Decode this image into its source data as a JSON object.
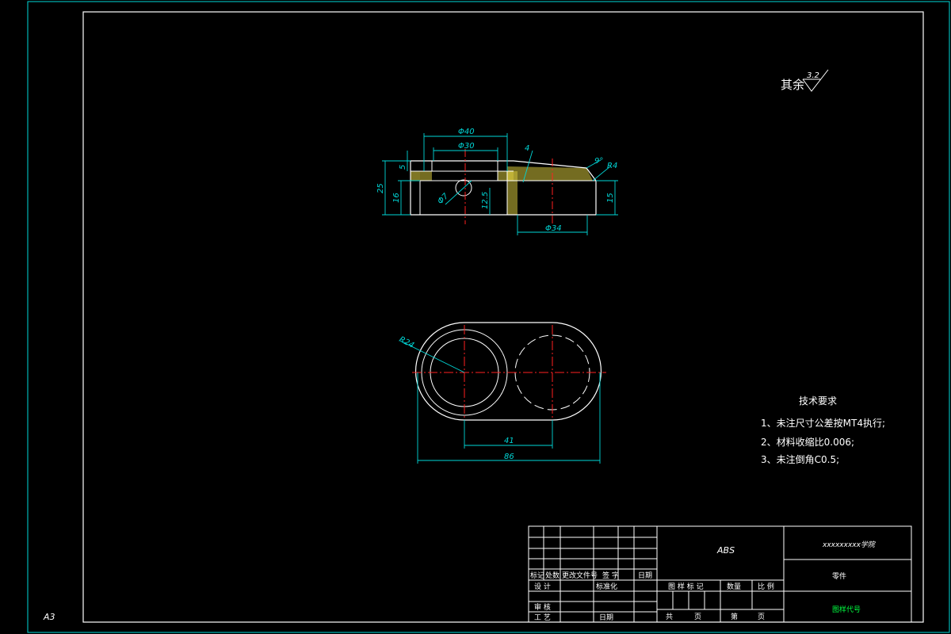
{
  "sheet": {
    "size_label": "A3"
  },
  "surface_finish": {
    "label": "其余",
    "value": "3.2"
  },
  "front_view": {
    "dims": {
      "d40": "Φ40",
      "d30": "Φ30",
      "d7": "Φ7",
      "d34": "Φ34",
      "h25": "25",
      "h5": "5",
      "h16": "16",
      "h12_5": "12.5",
      "h15": "15",
      "t4": "4",
      "angle": "9°",
      "r4": "R4"
    }
  },
  "top_view": {
    "dims": {
      "r24": "R24",
      "w41": "41",
      "w86": "86"
    }
  },
  "tech_requirements": {
    "title": "技术要求",
    "items": [
      "1、未注尺寸公差按MT4执行;",
      "2、材料收缩比0.006;",
      "3、未注倒角C0.5;"
    ]
  },
  "title_block": {
    "material": "ABS",
    "school": "xxxxxxxxx学院",
    "part_name": "零件",
    "drawing_no": "图样代号",
    "headers": {
      "mark": "标记",
      "count": "处数",
      "doc_no": "更改文件号",
      "sign": "签 字",
      "date": "日期"
    },
    "roles": {
      "design": "设 计",
      "standard": "标准化",
      "review": "审 核",
      "process": "工 艺",
      "date2": "日期"
    },
    "sample_mark": "图 样 标 记",
    "quantity": "数量",
    "scale": "比 例",
    "total": "共",
    "page": "页",
    "sheet_no": "第",
    "page2": "页"
  }
}
